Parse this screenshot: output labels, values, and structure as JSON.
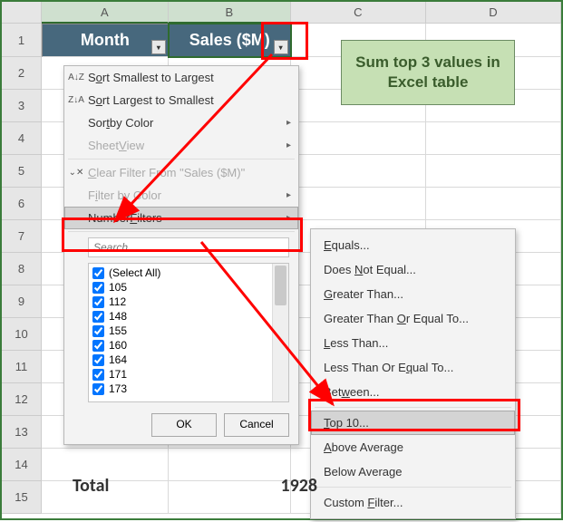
{
  "grid": {
    "columns": [
      "A",
      "B",
      "C",
      "D"
    ],
    "selected_columns": [
      "A",
      "B"
    ],
    "rows": [
      "1",
      "2",
      "3",
      "4",
      "5",
      "6",
      "7",
      "8",
      "9",
      "10",
      "11",
      "12",
      "13",
      "14",
      "15"
    ],
    "headers": {
      "col1": "Month",
      "col2": "Sales ($M)"
    },
    "totals": {
      "label": "Total",
      "value": "1928"
    }
  },
  "note": "Sum top 3 values in Excel table",
  "filter_menu": {
    "sort_asc": "Sort Smallest to Largest",
    "sort_desc": "Sort Largest to Smallest",
    "sort_color": "Sort by Color",
    "sheet_view": "Sheet View",
    "clear_filter": "Clear Filter From \"Sales ($M)\"",
    "filter_color": "Filter by Color",
    "number_filters": "Number Filters",
    "search_placeholder": "Search",
    "check_items": [
      "(Select All)",
      "105",
      "112",
      "148",
      "155",
      "160",
      "164",
      "171",
      "173"
    ],
    "ok": "OK",
    "cancel": "Cancel"
  },
  "submenu": {
    "equals": "Equals...",
    "not_equal": "Does Not Equal...",
    "greater": "Greater Than...",
    "ge": "Greater Than Or Equal To...",
    "less": "Less Than...",
    "le": "Less Than Or Equal To...",
    "between": "Between...",
    "top10": "Top 10...",
    "above_avg": "Above Average",
    "below_avg": "Below Average",
    "custom": "Custom Filter..."
  }
}
